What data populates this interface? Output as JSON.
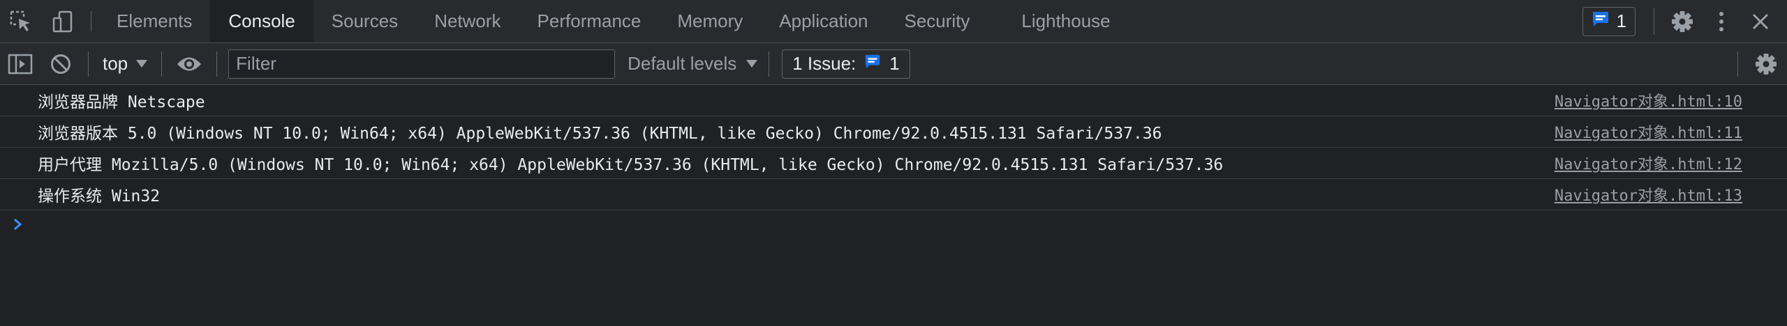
{
  "tabs": [
    {
      "label": "Elements"
    },
    {
      "label": "Console"
    },
    {
      "label": "Sources"
    },
    {
      "label": "Network"
    },
    {
      "label": "Performance"
    },
    {
      "label": "Memory"
    },
    {
      "label": "Application"
    },
    {
      "label": "Security"
    },
    {
      "label": "Lighthouse"
    }
  ],
  "active_tab": "Console",
  "header": {
    "message_badge_count": "1"
  },
  "toolbar": {
    "context": "top",
    "filter_placeholder": "Filter",
    "filter_value": "",
    "levels": "Default levels",
    "issues_label": "1 Issue:",
    "issues_count": "1"
  },
  "messages": [
    {
      "text": "浏览器品牌 Netscape",
      "source": "Navigator对象.html:10"
    },
    {
      "text": "浏览器版本 5.0 (Windows NT 10.0; Win64; x64) AppleWebKit/537.36 (KHTML, like Gecko) Chrome/92.0.4515.131 Safari/537.36",
      "source": "Navigator对象.html:11"
    },
    {
      "text": "用户代理 Mozilla/5.0 (Windows NT 10.0; Win64; x64) AppleWebKit/537.36 (KHTML, like Gecko) Chrome/92.0.4515.131 Safari/537.36",
      "source": "Navigator对象.html:12"
    },
    {
      "text": "操作系统 Win32",
      "source": "Navigator对象.html:13"
    }
  ],
  "icons": {
    "inspect": "inspect-element-icon",
    "device": "device-toolbar-icon",
    "message": "message-icon",
    "settings": "gear-icon",
    "more": "kebab-menu-icon",
    "close": "close-icon",
    "sidebar": "sidebar-toggle-icon",
    "clear": "clear-console-icon",
    "eye": "live-expression-eye-icon",
    "prompt": "chevron-right-icon"
  },
  "colors": {
    "accent": "#1a73e8",
    "prompt": "#3c8df7",
    "background": "#202124",
    "toolbar": "#292a2d"
  }
}
